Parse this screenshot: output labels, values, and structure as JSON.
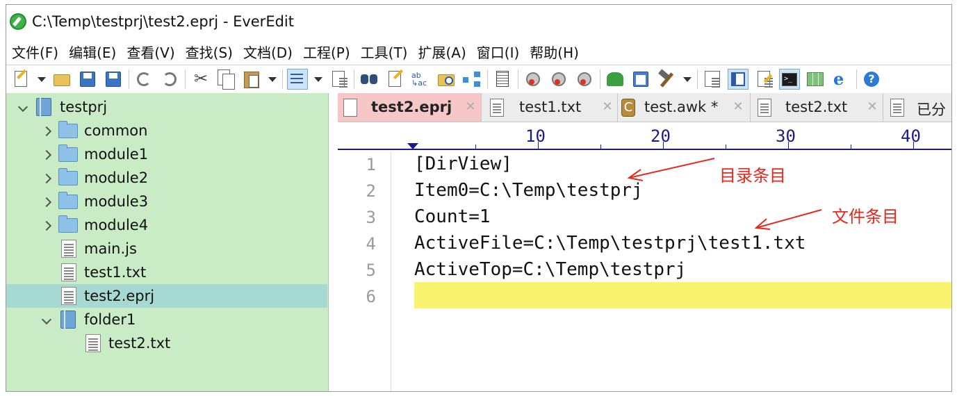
{
  "window": {
    "title": "C:\\Temp\\testprj\\test2.eprj - EverEdit"
  },
  "menu": [
    "文件(F)",
    "编辑(E)",
    "查看(V)",
    "查找(S)",
    "文档(D)",
    "工程(P)",
    "工具(T)",
    "扩展(A)",
    "窗口(I)",
    "帮助(H)"
  ],
  "toolbar": {
    "icons": [
      "new-icon",
      "open-icon",
      "save-icon",
      "save-all-icon",
      "undo-icon",
      "redo-icon",
      "cut-icon",
      "copy-icon",
      "paste-icon",
      "wrap-icon",
      "list-icon",
      "find-icon",
      "edit-icon",
      "replace-icon",
      "find-files-icon",
      "compare-icon",
      "hex-icon",
      "record-icon",
      "play-icon",
      "macro-icon",
      "plugin-icon",
      "window-icon",
      "build-icon",
      "outline-icon",
      "sidebar-icon",
      "clip-icon",
      "console-icon",
      "grid-icon",
      "browser-icon",
      "help-icon"
    ]
  },
  "tree": {
    "root": "testprj",
    "items": [
      {
        "label": "common",
        "type": "folder"
      },
      {
        "label": "module1",
        "type": "folder"
      },
      {
        "label": "module2",
        "type": "folder"
      },
      {
        "label": "module3",
        "type": "folder"
      },
      {
        "label": "module4",
        "type": "folder"
      },
      {
        "label": "main.js",
        "type": "file"
      },
      {
        "label": "test1.txt",
        "type": "file"
      },
      {
        "label": "test2.eprj",
        "type": "file",
        "selected": true
      },
      {
        "label": "folder1",
        "type": "project-folder"
      },
      {
        "label": "test2.txt",
        "type": "file"
      }
    ]
  },
  "tabs": [
    {
      "label": "test2.eprj",
      "active": true
    },
    {
      "label": "test1.txt"
    },
    {
      "label": "test.awk *",
      "icon_letter": "C"
    },
    {
      "label": "test2.txt"
    },
    {
      "label": "已分"
    }
  ],
  "ruler": {
    "labels": [
      "10",
      "20",
      "30",
      "40"
    ]
  },
  "editor": {
    "lines": [
      {
        "n": "1",
        "text": "[DirView]"
      },
      {
        "n": "2",
        "text": "Item0=C:\\Temp\\testprj"
      },
      {
        "n": "3",
        "text": "Count=1"
      },
      {
        "n": "4",
        "text": "ActiveFile=C:\\Temp\\testprj\\test1.txt"
      },
      {
        "n": "5",
        "text": "ActiveTop=C:\\Temp\\testprj"
      },
      {
        "n": "6",
        "text": ""
      }
    ],
    "current_line_color": "#f8f46e"
  },
  "annotations": {
    "dir_entry": "目录条目",
    "file_entry": "文件条目",
    "color": "#e8271c"
  }
}
